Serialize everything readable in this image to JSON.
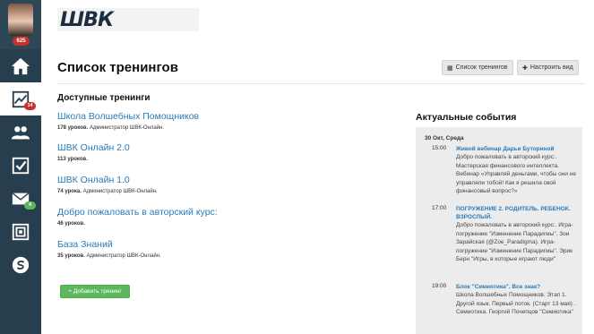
{
  "sidebar": {
    "avatar_count": "625",
    "items": [
      {
        "name": "home",
        "badge": ""
      },
      {
        "name": "trainings",
        "badge": "14"
      },
      {
        "name": "users",
        "badge": ""
      },
      {
        "name": "tasks",
        "badge": ""
      },
      {
        "name": "messages",
        "badge": "4"
      },
      {
        "name": "archive",
        "badge": ""
      },
      {
        "name": "skype",
        "badge": ""
      }
    ]
  },
  "header": {
    "logo_text": "ШВК",
    "page_title": "Список тренингов",
    "btn_list_label": "Список тренингов",
    "btn_customize_label": "Настроить вид"
  },
  "trainings": {
    "section_title": "Доступные тренинги",
    "items": [
      {
        "title": "Школа Волшебных Помощников",
        "lessons": "178 уроков.",
        "admin": "Администратор ШВК-Онлайн."
      },
      {
        "title": "ШВК Онлайн 2.0",
        "lessons": "113 уроков.",
        "admin": ""
      },
      {
        "title": "ШВК Онлайн 1.0",
        "lessons": "74 урока.",
        "admin": "Администратор ШВК-Онлайн."
      },
      {
        "title": "Добро пожаловать в авторский курс:",
        "lessons": "46 уроков.",
        "admin": ""
      },
      {
        "title": "База Знаний",
        "lessons": "35 уроков.",
        "admin": "Администратор ШВК-Онлайн."
      }
    ],
    "add_button_label": "+ Добавить тренинг"
  },
  "events": {
    "title": "Актуальные события",
    "date": "30 Окт, Среда",
    "items": [
      {
        "time": "15:00",
        "title": "Живой вебинар Дарьи Буториной",
        "desc": "Добро пожаловать в авторский курс:. Мастерская финансового интеллекта. Вебинар «Управляй деньгами, чтобы они не управляли тобой! Как я решила свой финансовый вопрос?»"
      },
      {
        "time": "17:00",
        "title": "ПОГРУЖЕНИЕ 2. РОДИТЕЛЬ. РЕБЕНОК. ВЗРОСЛЫЙ.",
        "desc": "Добро пожаловать в авторский курс:. Игра-погружение \"Изменение Парадигмы\". Зои Зарайская (@Zoe_Paradigma). Игра-погружение \"Изменение Парадигмы\". Эрик Берн \"Игры, в которые играют люди\""
      },
      {
        "time": "19:00",
        "title": "Блок \"Семиотика\". Все знак?",
        "desc": "Школа Волшебных Помощников. Этап 1. Другой язык. Первый поток. (Старт 13 мая) . Семиотика. Георгий Почепцов \"Семиотика\""
      }
    ]
  }
}
